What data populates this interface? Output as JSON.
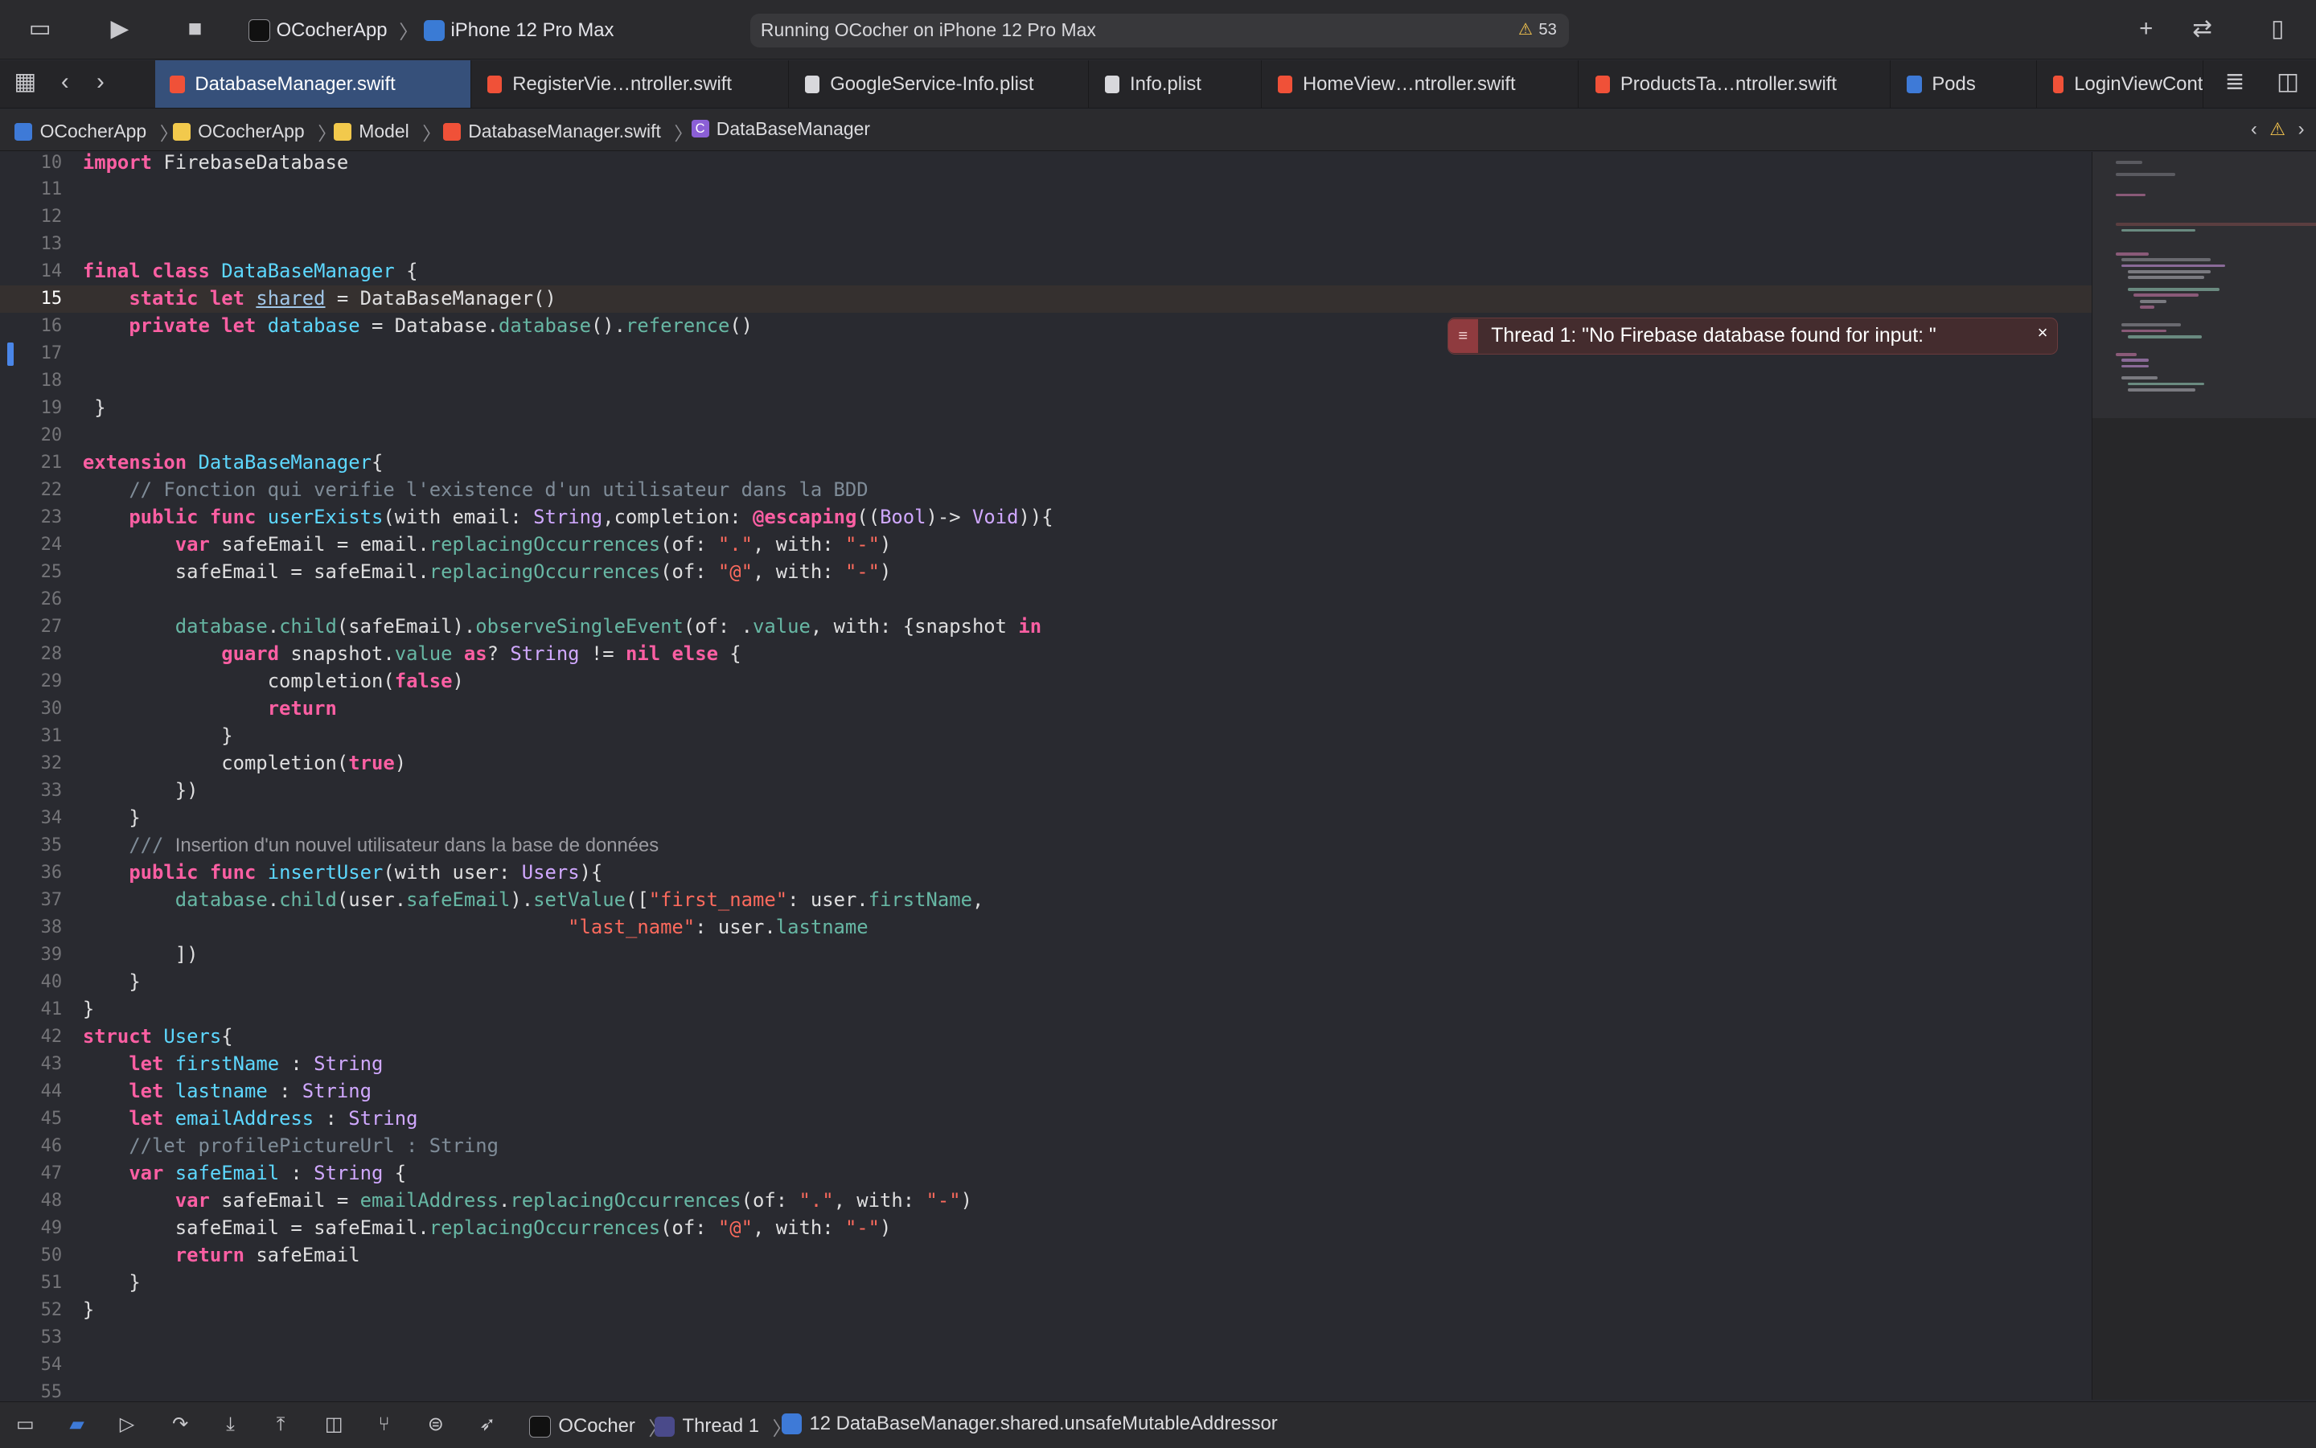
{
  "toolbar": {
    "scheme": "OCocherApp",
    "device": "iPhone 12 Pro Max",
    "activity": "Running OCocher on iPhone 12 Pro Max",
    "warning_count": "53",
    "warning_glyph": "⚠"
  },
  "tabs": [
    {
      "label": "DatabaseManager.swift"
    },
    {
      "label": "RegisterVie…ntroller.swift"
    },
    {
      "label": "GoogleService-Info.plist"
    },
    {
      "label": "Info.plist"
    },
    {
      "label": "HomeView…ntroller.swift"
    },
    {
      "label": "ProductsTa…ntroller.swift"
    },
    {
      "label": "Pods"
    },
    {
      "label": "LoginViewCont"
    }
  ],
  "jumpbar": {
    "project": "OCocherApp",
    "group": "OCocherApp",
    "folder": "Model",
    "file": "DatabaseManager.swift",
    "class_badge": "C",
    "symbol": "DataBaseManager"
  },
  "error": {
    "message": "Thread 1: \"No Firebase database found for input: \"",
    "close": "×"
  },
  "code": {
    "l10": "10",
    "l11": "11",
    "l12": "12",
    "l13": "13",
    "l14": "14",
    "l15": "15",
    "l16": "16",
    "l17": "17",
    "l18": "18",
    "l19": "19",
    "l20": "20",
    "l21": "21",
    "l22": "22",
    "l23": "23",
    "l24": "24",
    "l25": "25",
    "l26": "26",
    "l27": "27",
    "l28": "28",
    "l29": "29",
    "l30": "30",
    "l31": "31",
    "l32": "32",
    "l33": "33",
    "l34": "34",
    "l35": "35",
    "l36": "36",
    "l37": "37",
    "l38": "38",
    "l39": "39",
    "l40": "40",
    "l41": "41",
    "l42": "42",
    "l43": "43",
    "l44": "44",
    "l45": "45",
    "l46": "46",
    "l47": "47",
    "l48": "48",
    "l49": "49",
    "l50": "50",
    "l51": "51",
    "l52": "52",
    "l53": "53",
    "l54": "54",
    "l55": "55",
    "t_import": "import",
    "t_firebase": "FirebaseDatabase",
    "t_final": "final class",
    "t_dbm": "DataBaseManager",
    "t_brace_open": " {",
    "t_static": "static let",
    "t_shared": "shared",
    "t_eq": " = ",
    "t_dbm_init": "DataBaseManager()",
    "t_private": "private let",
    "t_database": "database",
    "t_database_cls": "Database",
    "t_dot": ".",
    "t_database_fn": "database",
    "t_paren_dot": "().",
    "t_reference": "reference",
    "t_parens": "()",
    "t_close19": " }",
    "t_extension": "extension",
    "t_brace": "{",
    "t_comment22": "// Fonction qui verifie l'existence d'un utilisateur dans la BDD",
    "t_public_func": "public func",
    "t_userExists": "userExists",
    "t_with_email": "(with email: ",
    "t_String": "String",
    "t_completion": ",completion: ",
    "t_escaping": "@escaping",
    "t_open2": "((",
    "t_Bool": "Bool",
    "t_arrow": ")-> ",
    "t_Void": "Void",
    "t_close_open": ")){",
    "t_var": "var",
    "t_safeEmail_decl": " safeEmail = email.",
    "t_replacing": "replacingOccurrences",
    "t_of": "(of: ",
    "t_dot_str": "\".\"",
    "t_with": ", with: ",
    "t_dash_str": "\"-\"",
    "t_close_paren": ")",
    "t_safeEmail_assign": "safeEmail = safeEmail.",
    "t_at_str": "\"@\"",
    "t_child": "child",
    "t_child_arg": "(safeEmail).",
    "t_observe": "observeSingleEvent",
    "t_of_value": "(of: .",
    "t_value": "value",
    "t_with_snapshot": ", with: {snapshot ",
    "t_in": "in",
    "t_guard": "guard",
    "t_snapshot": " snapshot.",
    "t_as": " as",
    "t_q": "? ",
    "t_neq": " != ",
    "t_nil": "nil",
    "t_else": " else",
    "t_brace_sp": " {",
    "t_completion_call": "completion(",
    "t_false": "false",
    "t_return": "return",
    "t_close_brace": "}",
    "t_true": "true",
    "t_close33": "})",
    "t_doc_prefix": "/// ",
    "t_doc35": "Insertion d'un nouvel utilisateur dans la base de données",
    "t_insertUser": "insertUser",
    "t_with_user": "(with user: ",
    "t_Users": "Users",
    "t_paren_brace": "){",
    "t_child_user": "(user.",
    "t_safeEmail": "safeEmail",
    "t_paren_dot2": ").",
    "t_setValue": "setValue",
    "t_open_bracket": "([",
    "t_first_name": "\"first_name\"",
    "t_colon_user": ": user.",
    "t_firstName": "firstName",
    "t_comma": ",",
    "t_last_name": "\"last_name\"",
    "t_lastname": "lastname",
    "t_close39": "])",
    "t_struct": "struct",
    "t_let": "let",
    "t_colon": " : ",
    "t_emailAddress": "emailAddress",
    "t_comment46": "//let profilePictureUrl : String",
    "t_colon_brace_pre": " : ",
    "t_safeEmail_var": " safeEmail = ",
    "t_emailAddress_dot": "emailAddress",
    "t_return_safe": " safeEmail"
  },
  "debugbar": {
    "target": "OCocher",
    "thread": "Thread 1",
    "frame": "12 DataBaseManager.shared.unsafeMutableAddressor"
  },
  "colors": {
    "accent": "#3e7ad7",
    "keyword": "#fc5fa3",
    "string": "#fc6a5d",
    "type": "#d0a8ff",
    "function": "#67b7a4",
    "comment": "#7f8c98",
    "error_bg": "#442c2e"
  }
}
